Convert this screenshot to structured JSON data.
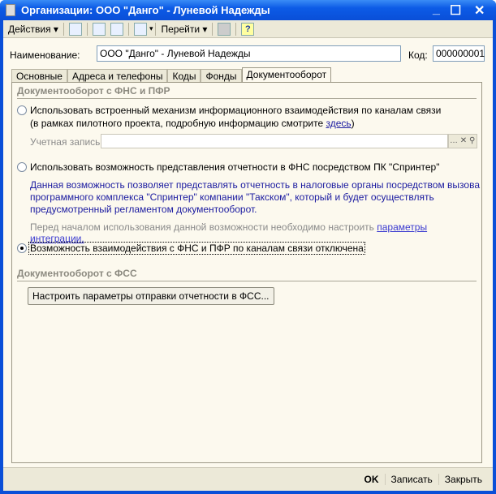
{
  "window": {
    "title": "Организации: ООО \"Данго\" - Луневой Надежды"
  },
  "toolbar": {
    "actions": "Действия",
    "goto": "Перейти",
    "help": "?"
  },
  "form": {
    "name_label": "Наименование:",
    "name_value": "ООО \"Данго\" - Луневой Надежды",
    "code_label": "Код:",
    "code_value": "000000001"
  },
  "tabs": [
    "Основные",
    "Адреса и телефоны",
    "Коды",
    "Фонды",
    "Документооборот"
  ],
  "fns": {
    "section": "Документооборот с ФНС и ПФР",
    "opt1": "Использовать встроенный механизм информационного взаимодействия по каналам связи",
    "opt1_note": "(в рамках пилотного проекта, подробную информацию смотрите ",
    "opt1_link": "здесь",
    "opt1_close": ")",
    "account_label": "Учетная запись:",
    "account_value": "",
    "opt2": "Использовать возможность представления отчетности в ФНС посредством ПК \"Спринтер\"",
    "opt2_desc1": "Данная возможность позволяет представлять отчетность в налоговые органы посредством вызова",
    "opt2_desc2": "программного комплекса \"Спринтер\" компании \"Такском\", который и будет осуществлять",
    "opt2_desc3": "предусмотренный регламентом документооборот.",
    "opt2_note": "Перед началом использования данной возможности необходимо настроить ",
    "opt2_link": "параметры интеграции.",
    "opt3": "Возможность взаимодействия с ФНС и ПФР по каналам связи отключена",
    "selected": 3
  },
  "fss": {
    "section": "Документооборот с ФСС",
    "button": "Настроить параметры отправки отчетности в ФСС..."
  },
  "footer": {
    "ok": "OK",
    "save": "Записать",
    "close": "Закрыть"
  }
}
